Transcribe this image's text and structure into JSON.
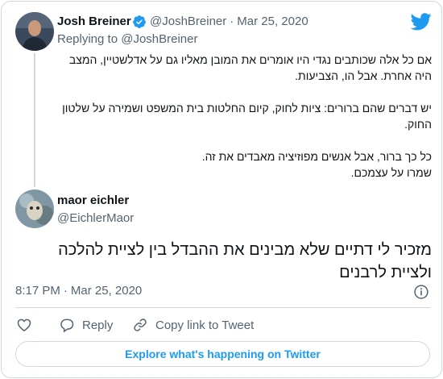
{
  "parent_tweet": {
    "author_name": "Josh Breiner",
    "author_handle": "@JoshBreiner",
    "separator": "·",
    "date": "Mar 25, 2020",
    "verified": true,
    "text_lines": [
      "אם כל אלה שכותבים נגדי היו אומרים את המובן מאליו גם על אדלשטיין, המצב",
      "היה אחרת. אבל הו, הצביעות.",
      "",
      "יש דברים שהם ברורים: ציות לחוק, קיום החלטות בית המשפט ושמירה על שלטון",
      "החוק.",
      "",
      "כל כך ברור, אבל אנשים  מפוזיציה מאבדים את זה.",
      "שמרו על עצמכם."
    ]
  },
  "replying_to": {
    "label": "Replying to",
    "handle": "@JoshBreiner"
  },
  "reply_tweet": {
    "author_name": "maor eichler",
    "author_handle": "@EichlerMaor",
    "text": "מזכיר לי דתיים שלא מבינים את ההבדל בין לציית להלכה ולציית לרבנים",
    "timestamp_time": "8:17 PM",
    "separator": "·",
    "timestamp_date": "Mar 25, 2020"
  },
  "actions": {
    "like_icon": "heart-icon",
    "reply_label": "Reply",
    "copy_link_label": "Copy link to Tweet"
  },
  "explore_button_label": "Explore what's happening on Twitter",
  "colors": {
    "accent": "#1d9bf0",
    "secondary_text": "#536471",
    "border": "#cfd9de"
  }
}
